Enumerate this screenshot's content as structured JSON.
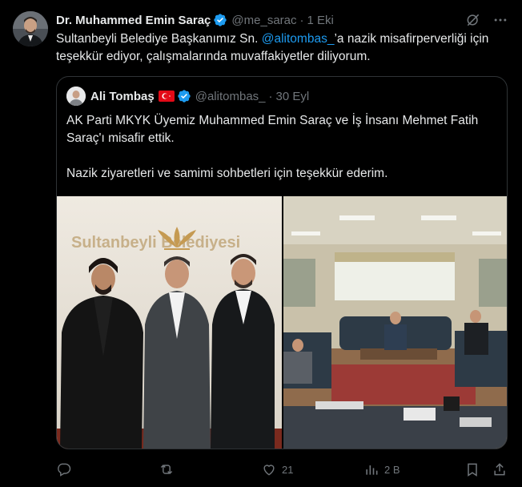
{
  "author": {
    "name": "Dr. Muhammed Emin Saraç",
    "handle": "@me_sarac",
    "separator": "·",
    "time": "1 Eki"
  },
  "tweet": {
    "text_before": "Sultanbeyli Belediye Başkanımız Sn. ",
    "mention": "@alitombas_",
    "text_after": "’a nazik misafirperverliği için teşekkür ediyor, çalışmalarında muvaffakiyetler diliyorum."
  },
  "quote": {
    "name": "Ali Tombaş",
    "handle": "@alitombas_",
    "separator": "·",
    "time": "30 Eyl",
    "paragraph1": "AK Parti MKYK Üyemiz Muhammed Emin Saraç ve İş İnsanı Mehmet Fatih Saraç'ı misafir ettik.",
    "paragraph2": "Nazik ziyaretleri ve samimi sohbetleri için teşekkür ederim.",
    "photo1_sign": "Sultanbeyli Belediyesi"
  },
  "actions": {
    "replies": "",
    "reposts": "",
    "likes": "21",
    "views": "2 B"
  },
  "colors": {
    "background": "#000000",
    "text": "#e7e9ea",
    "muted": "#71767b",
    "accent": "#1d9bf0",
    "border": "#2f3336"
  },
  "icons": [
    "grok-icon",
    "more-icon",
    "verified-icon",
    "turkey-flag-icon",
    "reply-icon",
    "repost-icon",
    "like-icon",
    "views-icon",
    "bookmark-icon",
    "share-icon"
  ]
}
